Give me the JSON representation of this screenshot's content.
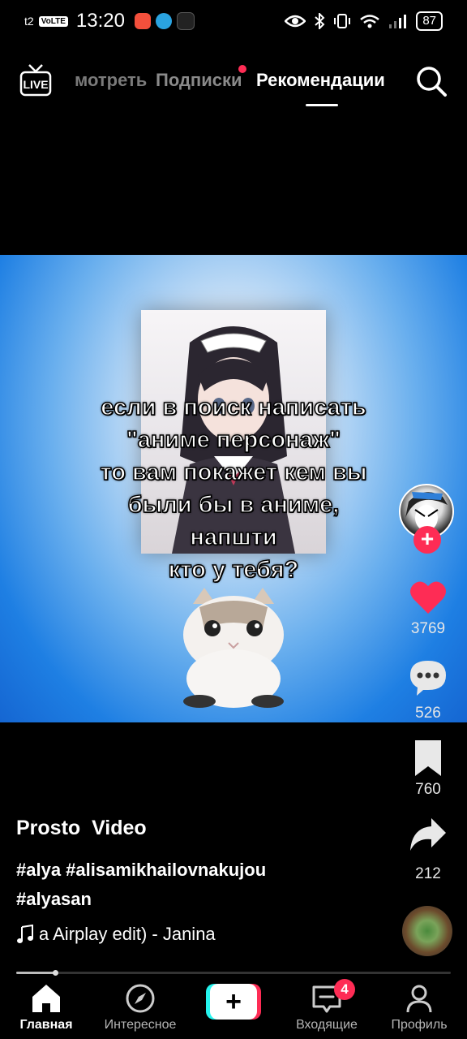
{
  "status_bar": {
    "carrier": "t2",
    "volte": "VoLTE",
    "time": "13:20",
    "battery": "87"
  },
  "top_nav": {
    "live_label": "LIVE",
    "tabs": [
      {
        "label": "мотреть"
      },
      {
        "label": "Подписки"
      },
      {
        "label": "Рекомендации"
      }
    ]
  },
  "video": {
    "caption_lines": [
      "если в поиск написать",
      "\"аниме персонаж\"",
      "то вам покажет кем вы",
      "были бы в аниме,",
      "напшти",
      "кто у тебя?"
    ]
  },
  "actions": {
    "likes": "3769",
    "comments": "526",
    "bookmarks": "760",
    "shares": "212",
    "like_color": "#fe2c55"
  },
  "post": {
    "author": "Prosto  Video",
    "hashtags": "#alya #alisamikhailovnakujou #alyasan",
    "music": "a Airplay edit) - Janina",
    "progress": 0.09
  },
  "bottom_nav": {
    "home": "Главная",
    "discover": "Интересное",
    "create": "+",
    "inbox": "Входящие",
    "inbox_badge": "4",
    "profile": "Профиль"
  }
}
